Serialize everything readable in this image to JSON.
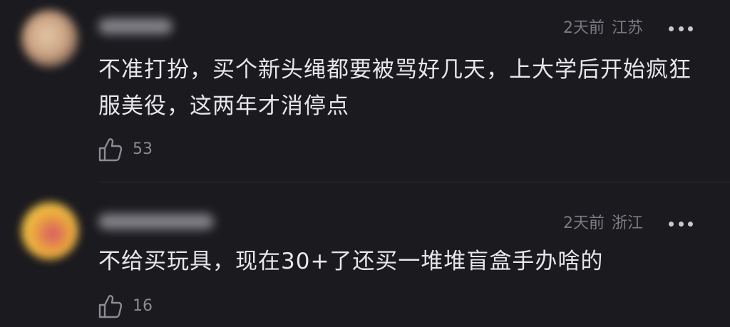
{
  "comments": [
    {
      "time": "2天前",
      "location": "江苏",
      "text": "不准打扮，买个新头绳都要被骂好几天，上大学后开始疯狂服美役，这两年才消停点",
      "likes": "53",
      "avatar_icon": "blurred-avatar",
      "username_blurred": true
    },
    {
      "time": "2天前",
      "location": "浙江",
      "text": "不给买玩具，现在30+了还买一堆堆盲盒手办啥的",
      "likes": "16",
      "avatar_icon": "blurred-avatar",
      "username_blurred": true
    }
  ],
  "icons": {
    "more": "more-icon",
    "like": "thumbs-up-icon"
  },
  "colors": {
    "background": "#1b1a1f",
    "text": "#e7e6ea",
    "meta": "#7c7b82"
  }
}
